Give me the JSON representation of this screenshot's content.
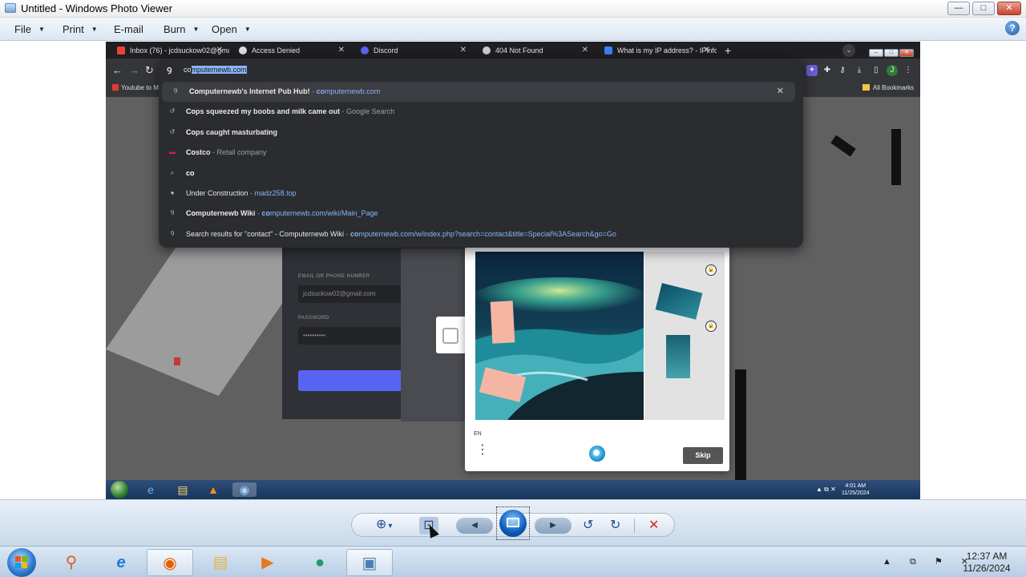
{
  "window": {
    "title": "Untitled - Windows Photo Viewer",
    "min_glyph": "—",
    "max_glyph": "□",
    "close_glyph": "✕"
  },
  "menu": {
    "file": "File",
    "print": "Print",
    "email": "E-mail",
    "burn": "Burn",
    "open": "Open",
    "dropdown_glyph": "▼",
    "help_glyph": "?"
  },
  "screenshot": {
    "tabs": [
      {
        "label": "Inbox (76) - jcdsuckow02@gma",
        "favicon_color": "#ea4335"
      },
      {
        "label": "Access Denied",
        "favicon_color": "#dddddd"
      },
      {
        "label": "Discord",
        "favicon_color": "#5865f2"
      },
      {
        "label": "404 Not Found",
        "favicon_color": "#cccccc"
      },
      {
        "label": "What is my IP address? - IPinfo",
        "favicon_color": "#3b82f6"
      }
    ],
    "tab_close_glyph": "✕",
    "new_tab_glyph": "+",
    "tab_menu_glyph": "⌄",
    "omnibox": {
      "typed": "co",
      "autocomplete_selected": "mputernewb.com",
      "close_glyph": "✕",
      "suggestions": [
        {
          "icon": "computernewb-icon",
          "glyph": "Ꝯ",
          "bold": "Co",
          "rest": "mputernewb's Internet Pub Hub!",
          "sep": " - ",
          "detail_bold": "co",
          "detail": "mputernewb.com",
          "detail_style": "url"
        },
        {
          "icon": "history-icon",
          "glyph": "↺",
          "bold": "Co",
          "rest": "ps squeezed my boobs and milk came out",
          "sep": " - ",
          "detail_bold": "",
          "detail": "Google Search",
          "detail_style": "grey"
        },
        {
          "icon": "history-icon",
          "glyph": "↺",
          "bold": "Co",
          "rest": "ps caught masturbating",
          "sep": "",
          "detail_bold": "",
          "detail": "",
          "detail_style": "grey"
        },
        {
          "icon": "costco-icon",
          "glyph": "▬",
          "bold": "Co",
          "rest": "stco",
          "sep": " - ",
          "detail_bold": "",
          "detail": "Retail company",
          "detail_style": "grey"
        },
        {
          "icon": "search-icon",
          "glyph": "⌕",
          "bold": "co",
          "rest": "",
          "sep": "",
          "detail_bold": "",
          "detail": "",
          "detail_style": "grey"
        },
        {
          "icon": "globe-icon",
          "glyph": "●",
          "bold": "",
          "rest": "Under Construction",
          "sep": " - ",
          "detail_bold": "",
          "detail": "madz258.top",
          "detail_style": "url"
        },
        {
          "icon": "computernewb-icon",
          "glyph": "Ꝯ",
          "bold": "Co",
          "rest": "mputernewb Wiki",
          "sep": " - ",
          "detail_bold": "co",
          "detail": "mputernewb.com/wiki/Main_Page",
          "detail_style": "url"
        },
        {
          "icon": "computernewb-icon",
          "glyph": "Ꝯ",
          "bold": "",
          "rest": "Search results for \"contact\" - Computernewb Wiki",
          "sep": " - ",
          "detail_bold": "co",
          "detail": "mputernewb.com/w/index.php?search=contact&title=Special%3ASearch&go=Go",
          "detail_style": "url"
        }
      ]
    },
    "bookmarks": {
      "first": "Youtube to M",
      "all": "All Bookmarks"
    },
    "login": {
      "email_label": "EMAIL OR PHONE NUMBER",
      "email_value": "jcdsuckow02@gmail.com",
      "password_label": "PASSWORD",
      "password_value": "••••••••••"
    },
    "captcha": {
      "lang": "EN",
      "menu_glyph": "⋮",
      "skip_label": "Skip",
      "lock_glyph": "🔒"
    },
    "inner_clock": {
      "time": "4:01 AM",
      "date": "11/25/2024"
    }
  },
  "controls": {
    "zoom_glyph": "⊕",
    "zoom_arrow": "▾",
    "actual_size_glyph": "⊡",
    "prev_glyph": "◀",
    "next_glyph": "▶",
    "rotate_ccw_glyph": "↺",
    "rotate_cw_glyph": "↻",
    "delete_glyph": "✕"
  },
  "taskbar": {
    "clock_time": "12:37 AM",
    "clock_date": "11/26/2024",
    "tray_glyphs": "▲ ⧉ ⚑ ✕"
  }
}
